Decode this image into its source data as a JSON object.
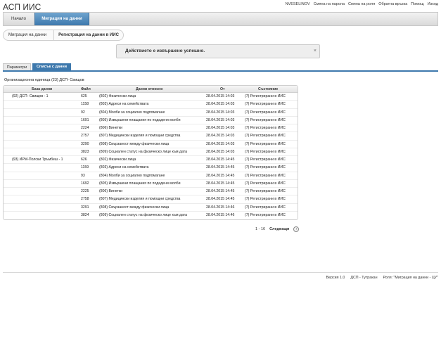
{
  "app": {
    "title": "АСП ИИС"
  },
  "top_links": [
    "NVESELINOV",
    "Смяна на парола",
    "Смяна на роля",
    "Обратна връзка",
    "Помощ",
    "Изход"
  ],
  "nav": {
    "home": "Начало",
    "active": "Миграция на данни"
  },
  "breadcrumb": {
    "parent": "Миграция на данни",
    "current": "Регистрация на данни в ИИС"
  },
  "message": {
    "text": "Действието е извършено успешно.",
    "close": "×"
  },
  "tabs": {
    "params": "Параметри",
    "list": "Списък с данни"
  },
  "org_unit": "Организационна единица (23) ДСП- Свищов",
  "grid": {
    "headers": {
      "base": "База данни",
      "file": "Файл",
      "data": "Данни относно",
      "from": "От",
      "state": "Състояние"
    },
    "rows": [
      {
        "base": "(92) ДСП- Свищов - 1",
        "file": "625",
        "data": "(802) Физически лица",
        "from": "28.04.2015 14:03",
        "state": "(7) Регистрирани в ИИС"
      },
      {
        "base": "",
        "file": "1158",
        "data": "(803) Адреси на семействата",
        "from": "28.04.2015 14:03",
        "state": "(7) Регистрирани в ИИС"
      },
      {
        "base": "",
        "file": "92",
        "data": "(804) Молби за социално подпомагане",
        "from": "28.04.2015 14:03",
        "state": "(7) Регистрирани в ИИС"
      },
      {
        "base": "",
        "file": "1691",
        "data": "(805) Извършени плащания по подадени молби",
        "from": "28.04.2015 14:03",
        "state": "(7) Регистрирани в ИИС"
      },
      {
        "base": "",
        "file": "2224",
        "data": "(806) Винетки",
        "from": "28.04.2015 14:03",
        "state": "(7) Регистрирани в ИИС"
      },
      {
        "base": "",
        "file": "2757",
        "data": "(807) Медицински изделия и помощни средства",
        "from": "28.04.2015 14:03",
        "state": "(7) Регистрирани в ИИС"
      },
      {
        "base": "",
        "file": "3290",
        "data": "(808) Свързаност между физически лица",
        "from": "28.04.2015 14:03",
        "state": "(7) Регистрирани в ИИС"
      },
      {
        "base": "",
        "file": "3823",
        "data": "(809) Социален статус на физическо лице към дата",
        "from": "28.04.2015 14:03",
        "state": "(7) Регистрирани в ИИС"
      },
      {
        "base": "(93) ИРМ-Полски Тръмбеш - 1",
        "file": "626",
        "data": "(802) Физически лица",
        "from": "28.04.2015 14:45",
        "state": "(7) Регистрирани в ИИС"
      },
      {
        "base": "",
        "file": "1159",
        "data": "(803) Адреси на семействата",
        "from": "28.04.2015 14:45",
        "state": "(7) Регистрирани в ИИС"
      },
      {
        "base": "",
        "file": "93",
        "data": "(804) Молби за социално подпомагане",
        "from": "28.04.2015 14:45",
        "state": "(7) Регистрирани в ИИС"
      },
      {
        "base": "",
        "file": "1692",
        "data": "(805) Извършени плащания по подадени молби",
        "from": "28.04.2015 14:45",
        "state": "(7) Регистрирани в ИИС"
      },
      {
        "base": "",
        "file": "2225",
        "data": "(806) Винетки",
        "from": "28.04.2015 14:45",
        "state": "(7) Регистрирани в ИИС"
      },
      {
        "base": "",
        "file": "2758",
        "data": "(807) Медицински изделия и помощни средства",
        "from": "28.04.2015 14:45",
        "state": "(7) Регистрирани в ИИС"
      },
      {
        "base": "",
        "file": "3291",
        "data": "(808) Свързаност между физически лица",
        "from": "28.04.2015 14:46",
        "state": "(7) Регистрирани в ИИС"
      },
      {
        "base": "",
        "file": "3824",
        "data": "(809) Социален статус на физическо лице към дата",
        "from": "28.04.2015 14:46",
        "state": "(7) Регистрирани в ИИС"
      }
    ]
  },
  "pager": {
    "range": "1 - 16",
    "next": "Следващи",
    "next_icon": "›"
  },
  "footer": {
    "version": "Версия 1.0",
    "unit": "ДСП - Тутракан",
    "role": "Роля: \"Миграция на данни - ЦУ\""
  }
}
